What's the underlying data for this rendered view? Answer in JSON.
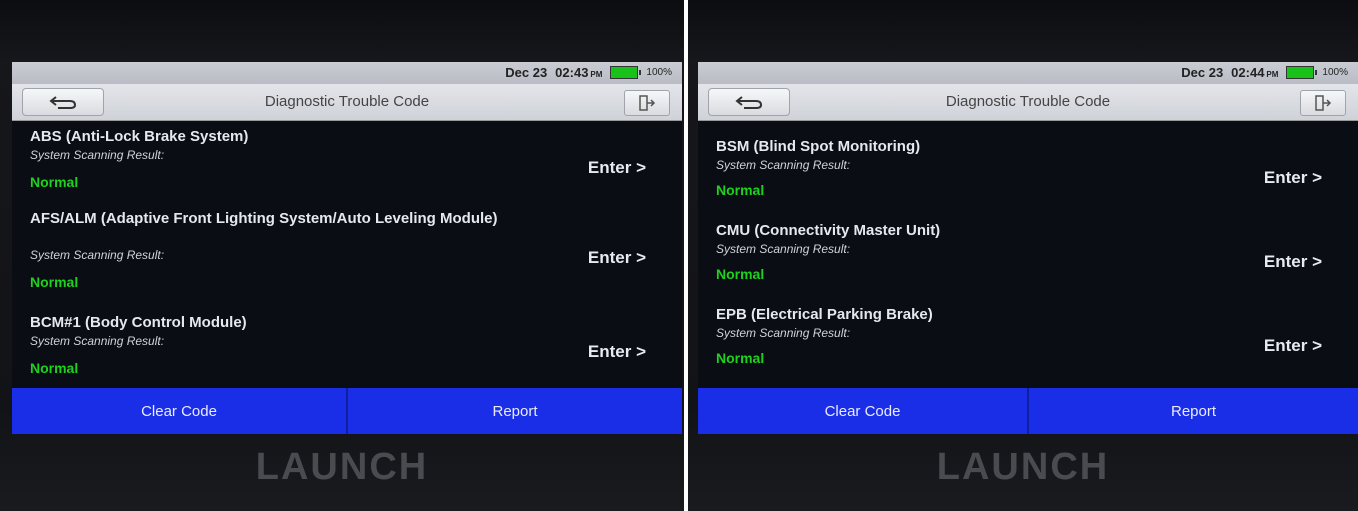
{
  "left_panel": {
    "status": {
      "date": "Dec 23",
      "time": "02:43",
      "ampm": "PM",
      "battery": "100%"
    },
    "title": "Diagnostic Trouble Code",
    "items": [
      {
        "name": "ABS (Anti-Lock Brake System)",
        "sub": "System Scanning Result:",
        "result": "Normal",
        "action": "Enter >"
      },
      {
        "name": "AFS/ALM (Adaptive Front Lighting System/Auto Leveling Module)",
        "sub": "System Scanning Result:",
        "result": "Normal",
        "action": "Enter >"
      },
      {
        "name": "BCM#1 (Body Control Module)",
        "sub": "System Scanning Result:",
        "result": "Normal",
        "action": "Enter >"
      }
    ],
    "buttons": {
      "clear": "Clear Code",
      "report": "Report"
    },
    "brand": "LAUNCH"
  },
  "right_panel": {
    "status": {
      "date": "Dec 23",
      "time": "02:44",
      "ampm": "PM",
      "battery": "100%"
    },
    "title": "Diagnostic Trouble Code",
    "items": [
      {
        "name": "BSM (Blind Spot Monitoring)",
        "sub": "System Scanning Result:",
        "result": "Normal",
        "action": "Enter >"
      },
      {
        "name": "CMU (Connectivity Master Unit)",
        "sub": "System Scanning Result:",
        "result": "Normal",
        "action": "Enter >"
      },
      {
        "name": "EPB (Electrical Parking Brake)",
        "sub": "System Scanning Result:",
        "result": "Normal",
        "action": "Enter >"
      }
    ],
    "buttons": {
      "clear": "Clear Code",
      "report": "Report"
    },
    "brand": "LAUNCH"
  },
  "colors": {
    "accent": "#1a2ee8",
    "status_ok": "#1fd11f",
    "battery": "#19c219"
  },
  "icons": {
    "back": "back-arrow-icon",
    "exit": "exit-icon",
    "battery": "battery-icon"
  }
}
